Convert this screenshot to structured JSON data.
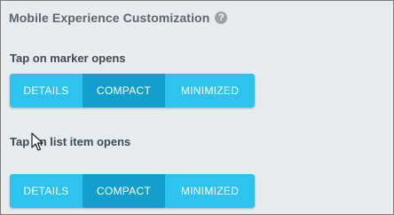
{
  "section": {
    "title": "Mobile Experience Customization",
    "help_icon": "?"
  },
  "marker_setting": {
    "label": "Tap on marker opens",
    "options": [
      "DETAILS",
      "COMPACT",
      "MINIMIZED"
    ],
    "selected": "COMPACT"
  },
  "list_setting": {
    "label": "Tap on list item opens",
    "options": [
      "DETAILS",
      "COMPACT",
      "MINIMIZED"
    ],
    "selected": "COMPACT"
  },
  "colors": {
    "button": "#2ec3ef",
    "button_active": "#129fcc",
    "background": "#e8ecef"
  },
  "icons": {
    "help": "question-circle-icon",
    "cursor": "mouse-pointer-icon"
  }
}
